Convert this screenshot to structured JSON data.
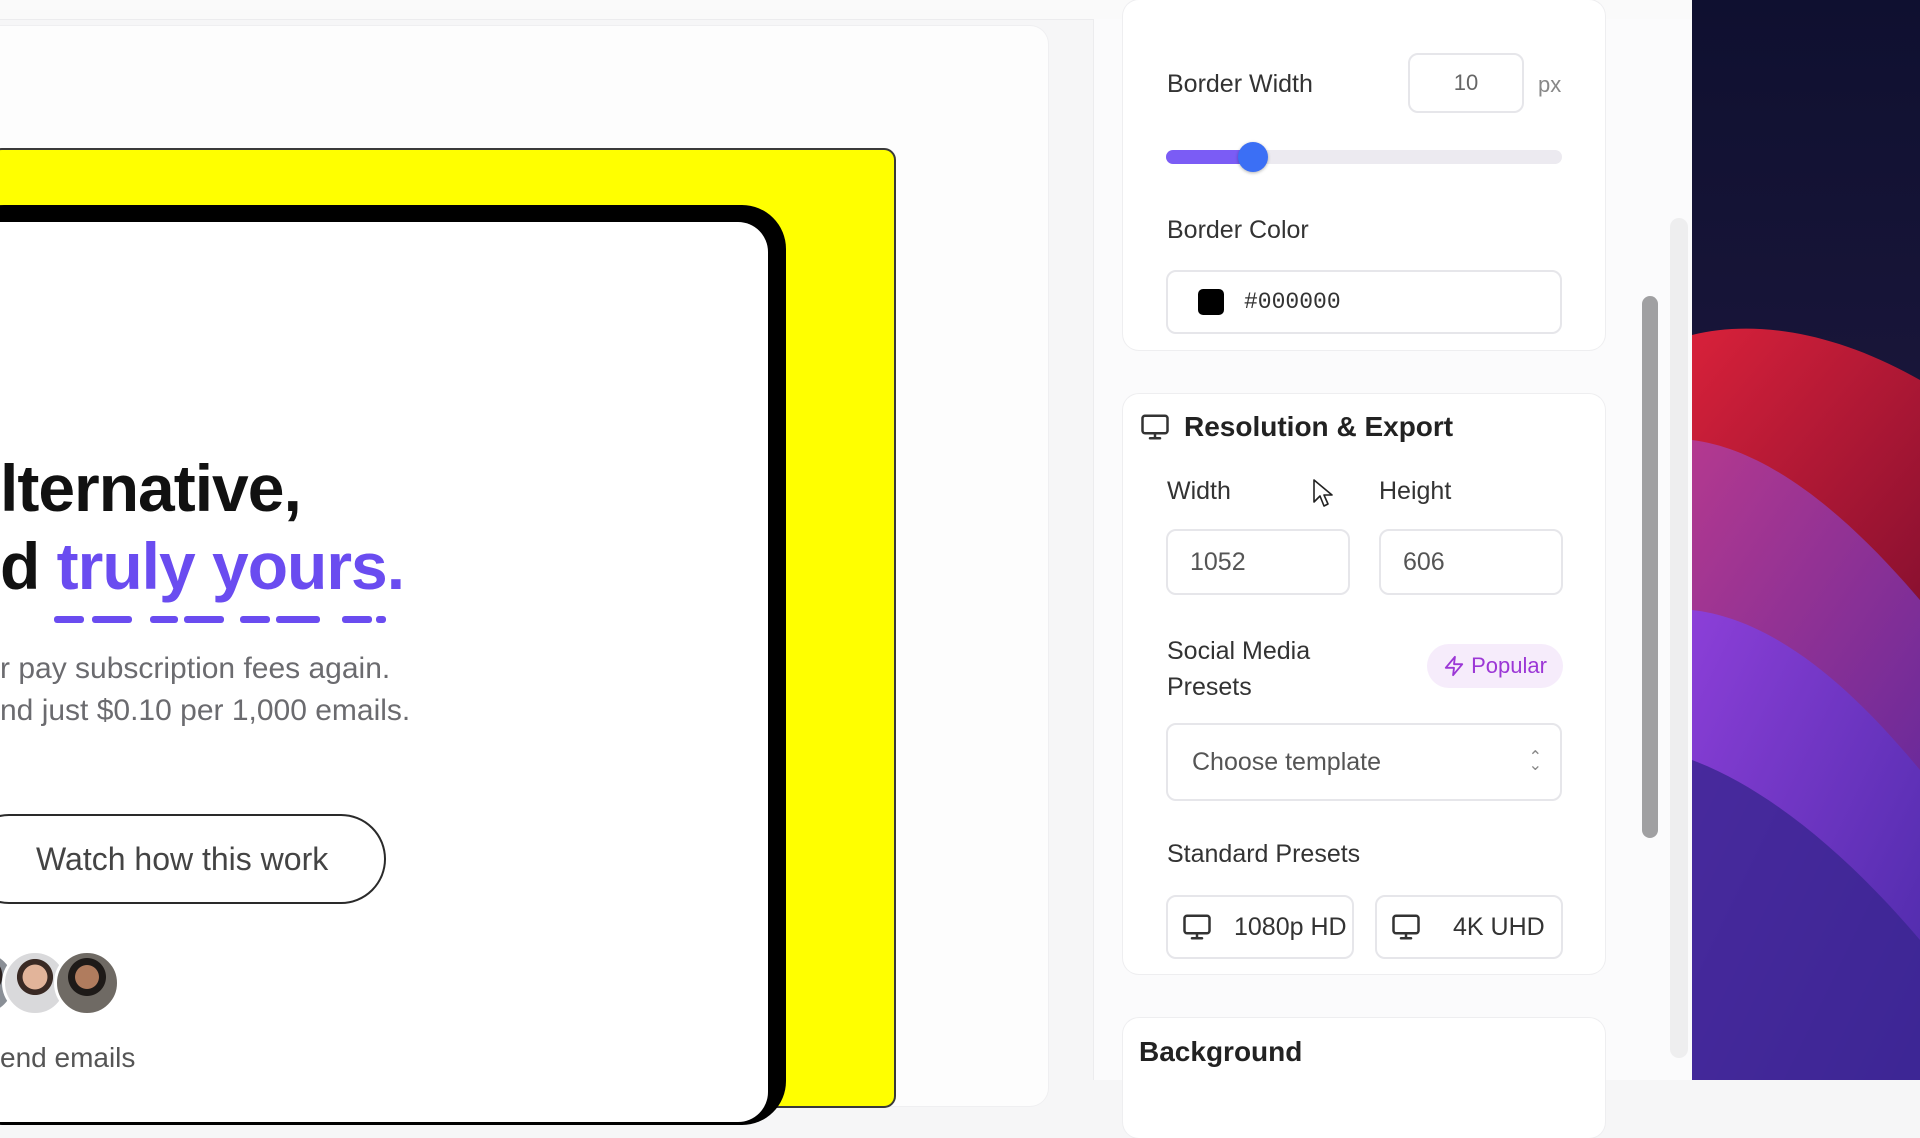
{
  "preview": {
    "headline_line1": "lternative,",
    "headline_line2_prefix": "d ",
    "headline_line2_accent": "truly yours.",
    "subtext_line1": "r pay subscription fees again.",
    "subtext_line2": "nd just $0.10 per 1,000 emails.",
    "watch_button": "Watch how this work",
    "send_text": "end emails",
    "colors": {
      "frame": "#ffff00",
      "border": "#000000",
      "accent": "#6a4cf0"
    }
  },
  "border": {
    "width_label": "Border Width",
    "width_value": "10",
    "width_unit": "px",
    "slider_fraction": 0.22,
    "color_label": "Border Color",
    "color_value": "#000000"
  },
  "resolution": {
    "title": "Resolution & Export",
    "width_label": "Width",
    "height_label": "Height",
    "width_value": "1052",
    "height_value": "606",
    "social_label": "Social Media Presets",
    "popular_badge": "Popular",
    "select_placeholder": "Choose template",
    "standard_label": "Standard Presets",
    "presets": [
      "1080p HD",
      "4K UHD"
    ]
  },
  "background": {
    "title": "Background"
  }
}
